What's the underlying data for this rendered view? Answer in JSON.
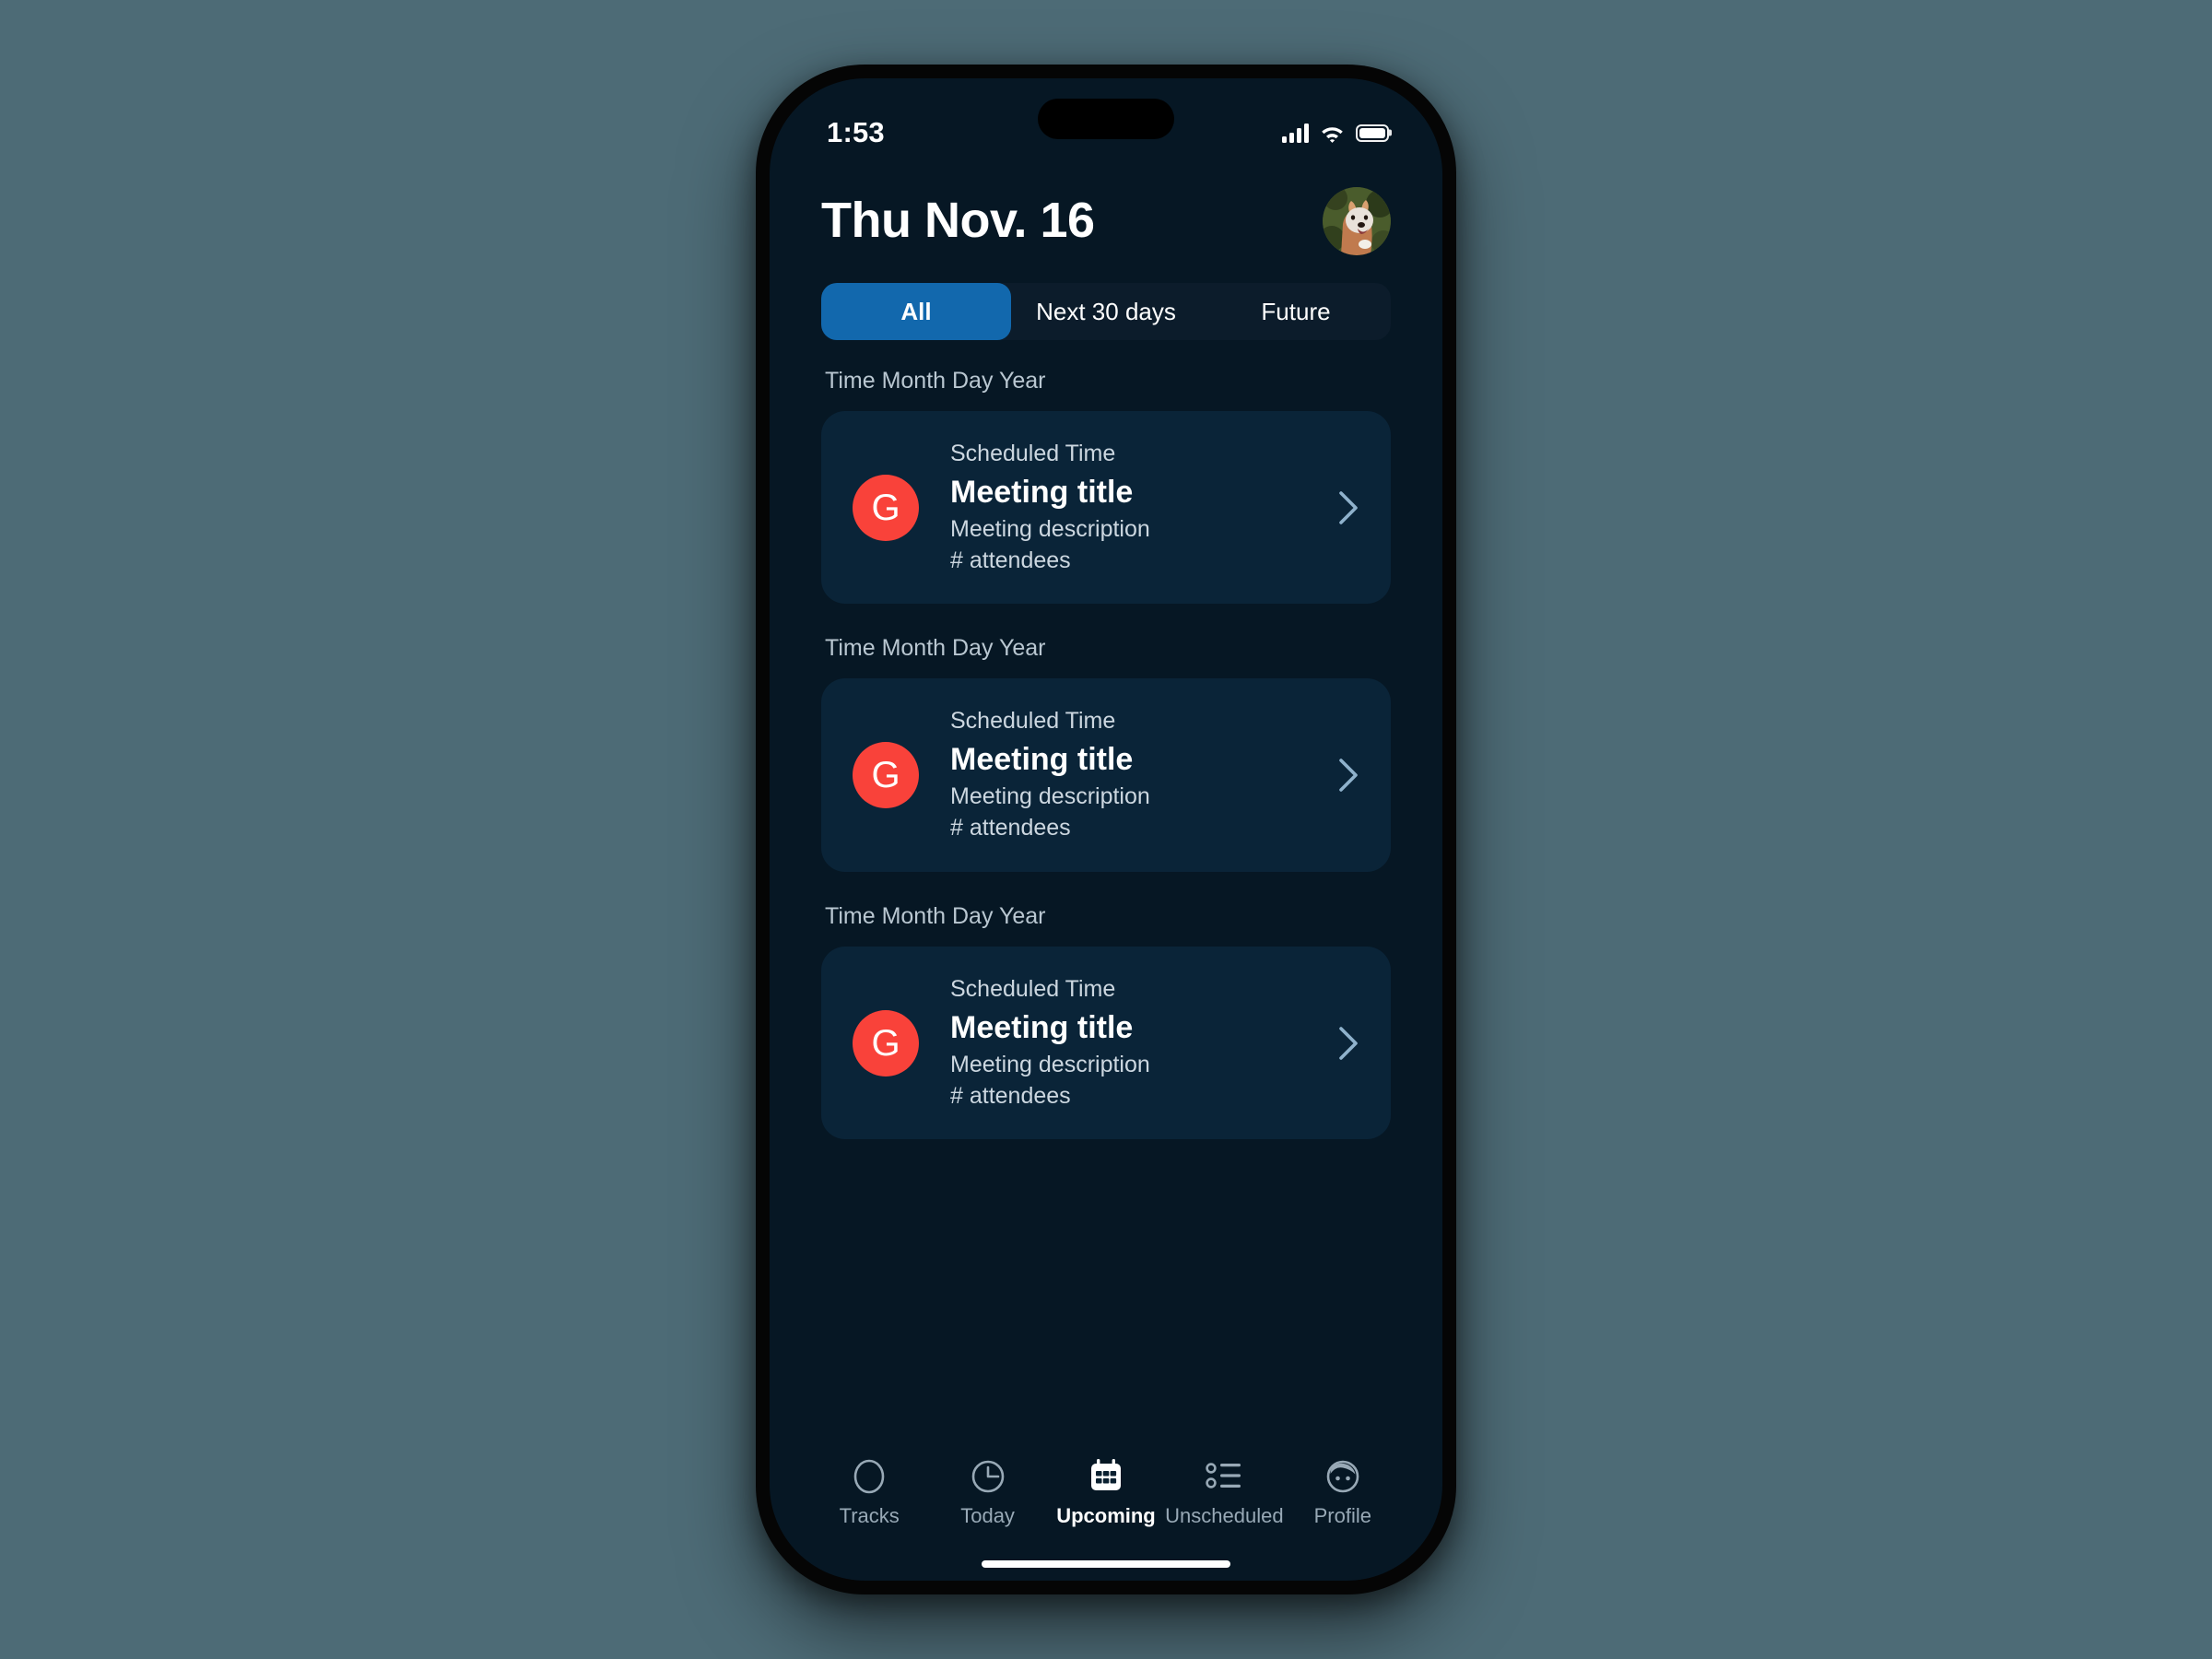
{
  "canvas": {
    "background_color": "#4d6b76"
  },
  "device": {
    "frame_color": "#050505",
    "screen_background": "#061724"
  },
  "status_bar": {
    "time": "1:53",
    "signal_icon": "cellular-signal-icon",
    "wifi_icon": "wifi-icon",
    "battery_icon": "battery-icon"
  },
  "header": {
    "title": "Thu Nov. 16",
    "avatar_alt": "dog-profile-photo"
  },
  "filter_tabs": {
    "active_index": 0,
    "active_color": "#1268ad",
    "track_color": "#0c1c2b",
    "items": [
      {
        "label": "All"
      },
      {
        "label": "Next 30 days"
      },
      {
        "label": "Future"
      }
    ]
  },
  "sections": [
    {
      "date_label": "Time Month Day Year",
      "card": {
        "badge_letter": "G",
        "badge_color": "#f9423a",
        "scheduled_time": "Scheduled Time",
        "title": "Meeting title",
        "description": "Meeting description",
        "attendees": "# attendees",
        "chevron": "chevron-right-icon"
      }
    },
    {
      "date_label": "Time Month Day Year",
      "card": {
        "badge_letter": "G",
        "badge_color": "#f9423a",
        "scheduled_time": "Scheduled Time",
        "title": "Meeting title",
        "description": "Meeting description",
        "attendees": "# attendees",
        "chevron": "chevron-right-icon"
      }
    },
    {
      "date_label": "Time Month Day Year",
      "card": {
        "badge_letter": "G",
        "badge_color": "#f9423a",
        "scheduled_time": "Scheduled Time",
        "title": "Meeting title",
        "description": "Meeting description",
        "attendees": "# attendees",
        "chevron": "chevron-right-icon"
      }
    }
  ],
  "tab_bar": {
    "active_index": 2,
    "active_color": "#ffffff",
    "inactive_color": "#98a9b6",
    "items": [
      {
        "label": "Tracks",
        "icon": "circle-outline-icon"
      },
      {
        "label": "Today",
        "icon": "clock-icon"
      },
      {
        "label": "Upcoming",
        "icon": "calendar-icon"
      },
      {
        "label": "Unscheduled",
        "icon": "bulleted-list-icon"
      },
      {
        "label": "Profile",
        "icon": "face-avatar-icon"
      }
    ]
  }
}
